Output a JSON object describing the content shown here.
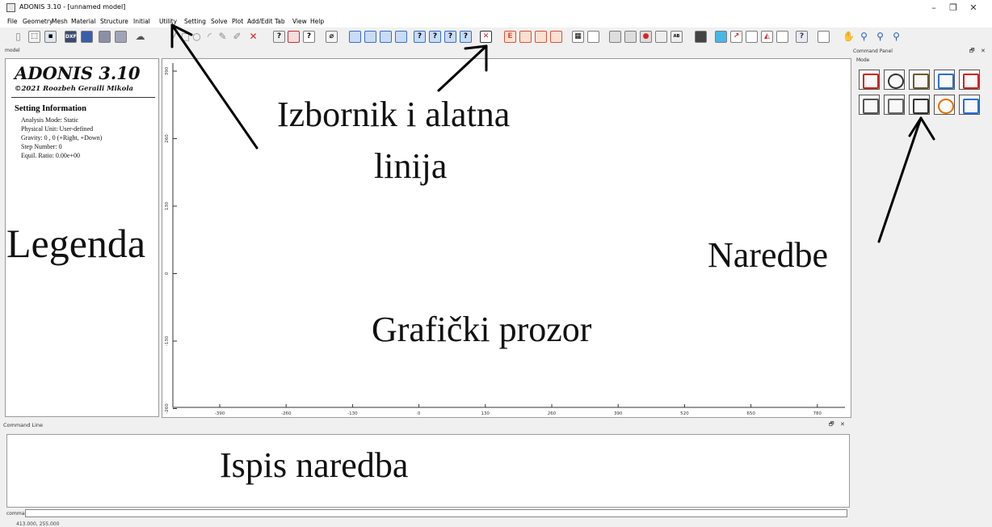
{
  "window": {
    "title": "ADONIS 3.10 - [unnamed model]",
    "minimize": "–",
    "maximize": "❐",
    "close": "✕"
  },
  "menu": [
    "File",
    "Geometry",
    "Mesh",
    "Material",
    "Structure",
    "Initial",
    "Utility",
    "Setting",
    "Solve",
    "Plot",
    "Add/Edit Tab",
    "View",
    "Help"
  ],
  "model_tab": "model",
  "legend": {
    "title": "ADONIS 3.10",
    "subtitle": "©2021 Roozbeh Geraili Mikola",
    "setting_header": "Setting Information",
    "lines": [
      "Analysis Mode: Static",
      "Physical Unit: User-defined",
      "Gravity: 0 , 0 (+Right, +Down)",
      "Step Number: 0",
      "Equil. Ratio: 0.00e+00"
    ]
  },
  "graph": {
    "x_ticks": [
      "-390",
      "-260",
      "-130",
      "0",
      "130",
      "260",
      "390",
      "520",
      "650",
      "780"
    ],
    "y_ticks": [
      "390",
      "260",
      "130",
      "0",
      "-130",
      "-260"
    ]
  },
  "command_panel": {
    "title": "Command Panel",
    "mode_label": "Mode",
    "close": "✕",
    "float": "🗗",
    "buttons": [
      {
        "icon": "no-geometry-icon",
        "color": "#d32020"
      },
      {
        "icon": "mesh-region-icon",
        "color": "#333333"
      },
      {
        "icon": "material-icon",
        "color": "#6b5a2a"
      },
      {
        "icon": "structure-beam-icon",
        "color": "#2a6fd3"
      },
      {
        "icon": "spring-icon",
        "color": "#d32020"
      },
      {
        "icon": "tools-icon",
        "color": "#555555"
      },
      {
        "icon": "gear-icon",
        "color": "#666666"
      },
      {
        "icon": "calculator-icon",
        "color": "#333333"
      },
      {
        "icon": "contour-rings-icon",
        "color": "#e07000"
      },
      {
        "icon": "new-page-icon",
        "color": "#2a6fd3"
      }
    ]
  },
  "command_line": {
    "title": "Command Line",
    "input_label": "command",
    "coords": "413.000, 255.000"
  },
  "annotations": {
    "menu_toolbar": [
      "Izbornik i alatna",
      "linija"
    ],
    "legend": "Legenda",
    "commands": "Naredbe",
    "graphics": "Grafički prozor",
    "command_output": "Ispis naredba"
  }
}
